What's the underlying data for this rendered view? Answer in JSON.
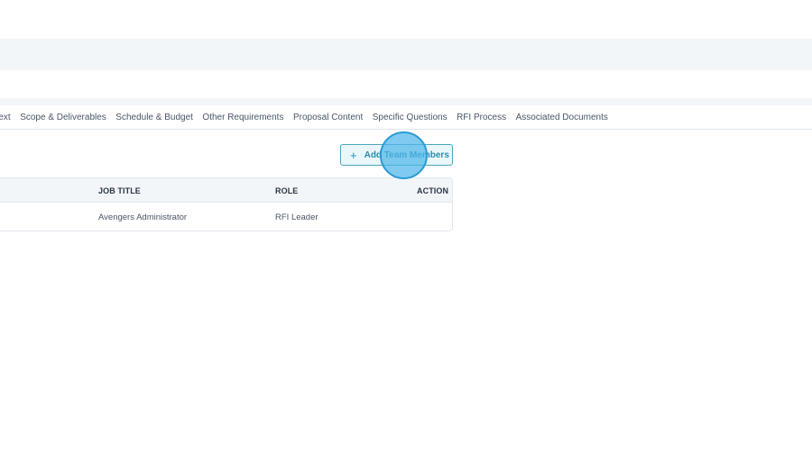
{
  "tabs": [
    {
      "label": "ntext"
    },
    {
      "label": "Scope & Deliverables"
    },
    {
      "label": "Schedule & Budget"
    },
    {
      "label": "Other Requirements"
    },
    {
      "label": "Proposal Content"
    },
    {
      "label": "Specific Questions"
    },
    {
      "label": "RFI Process"
    },
    {
      "label": "Associated Documents"
    }
  ],
  "add_button": {
    "icon": "plus-icon",
    "plus": "+",
    "label": "Add Team Members"
  },
  "table": {
    "headers": {
      "job_title": "JOB TITLE",
      "role": "ROLE",
      "action": "ACTION"
    },
    "rows": [
      {
        "job_title": "Avengers Administrator",
        "role": "RFI Leader"
      }
    ]
  },
  "colors": {
    "accent": "#2a8fb0",
    "cursor": "#4eb6e8"
  }
}
